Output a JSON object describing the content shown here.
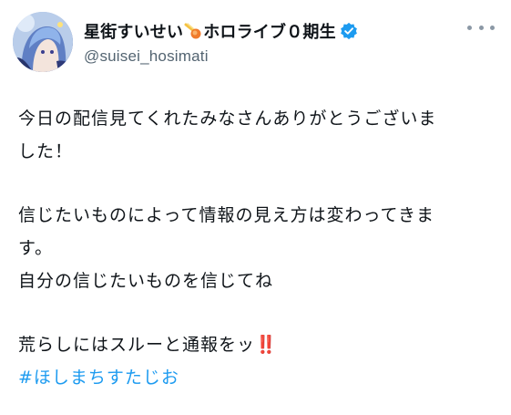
{
  "author": {
    "display_name": "星街すいせい",
    "display_name_suffix": "ホロライブ０期生",
    "handle": "@suisei_hosimati",
    "name_emoji_icon": "comet-icon",
    "verified_icon": "verified-badge-icon",
    "verified_color": "#1d9bf0"
  },
  "tweet": {
    "lines": [
      "今日の配信見てくれたみなさんありがとうございま",
      "した！",
      "信じたいものによって情報の見え方は変わってきま",
      "す。",
      "自分の信じたいものを信じてね",
      "荒らしにはスルーと通報をッ"
    ],
    "exclaim_emoji": "‼️",
    "hashtag": "#ほしまちすたじお"
  },
  "colors": {
    "text": "#0f1419",
    "secondary": "#536471",
    "link": "#1d9bf0",
    "emoji_red": "#e0245e"
  }
}
